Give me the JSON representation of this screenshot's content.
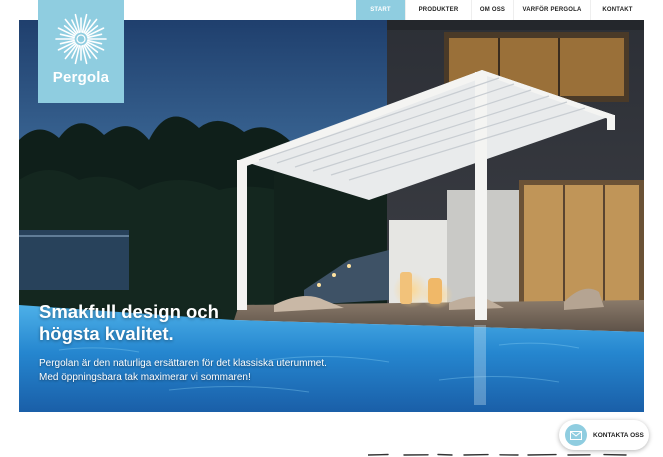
{
  "logo": {
    "text": "Pergola"
  },
  "nav": [
    {
      "label": "START",
      "active": true
    },
    {
      "label": "PRODUKTER",
      "active": false
    },
    {
      "label": "OM OSS",
      "active": false
    },
    {
      "label": "VARFÖR PERGOLA",
      "active": false
    },
    {
      "label": "KONTAKT",
      "active": false
    }
  ],
  "hero": {
    "headline_line1": "Smakfull design och",
    "headline_line2": "högsta kvalitet.",
    "sub_line1": "Pergolan är den naturliga ersättaren för det klassiska uterummet.",
    "sub_line2": "Med öppningsbara tak maximerar vi sommaren!"
  },
  "contact": {
    "label": "KONTAKTA OSS",
    "icon": "mail-icon"
  },
  "colors": {
    "accent": "#8fcde0",
    "pool": "#2f8fd0",
    "sky": "#2a4d7a"
  }
}
